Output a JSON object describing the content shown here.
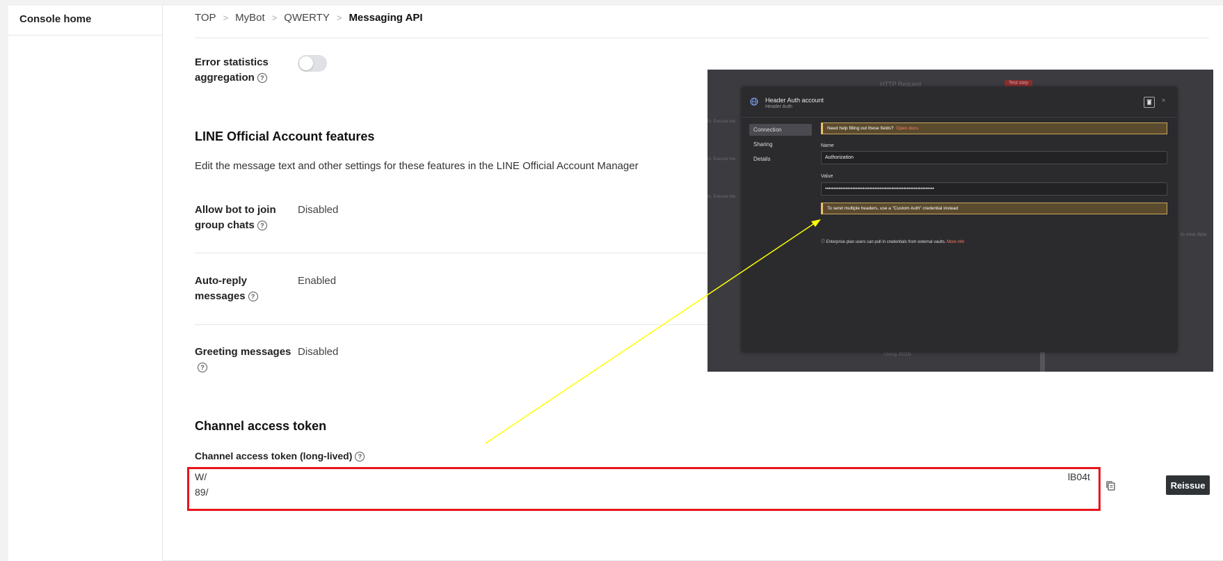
{
  "sidebar": {
    "home_label": "Console home"
  },
  "breadcrumb": [
    "TOP",
    "MyBot",
    "QWERTY",
    "Messaging API"
  ],
  "error_stats": {
    "label_line1": "Error statistics",
    "label_line2": "aggregation",
    "enabled": false
  },
  "features": {
    "heading": "LINE Official Account features",
    "description": "Edit the message text and other settings for these features in the LINE Official Account Manager",
    "rows": [
      {
        "label_line1": "Allow bot to join",
        "label_line2": "group chats",
        "value": "Disabled"
      },
      {
        "label_line1": "Auto-reply",
        "label_line2": "messages",
        "value": "Enabled"
      },
      {
        "label_line1": "Greeting messages",
        "label_line2": "",
        "value": "Disabled"
      }
    ]
  },
  "token": {
    "heading": "Channel access token",
    "field_label": "Channel access token (long-lived)",
    "line1_start": "W/",
    "line1_end": "lB04t",
    "line2_start": "89/",
    "reissue_label": "Reissue"
  },
  "overlay": {
    "annotation_color": "#ffff00",
    "highlight_color": "#e8141b",
    "bg_node_title": "HTTP Request",
    "bg_chip": "Test step",
    "bg_hint": "fo. Execute the",
    "bg_right_hint": "to view data",
    "bg_bottom": "Using JSON",
    "modal": {
      "title": "Header Auth account",
      "subtitle": "Header Auth",
      "close": "×",
      "nav": [
        "Connection",
        "Sharing",
        "Details"
      ],
      "help_banner": "Need help filling out these fields?",
      "help_link": "Open docs",
      "name_label": "Name",
      "name_value": "Authorization",
      "value_label": "Value",
      "value_masked": "••••••••••••••••••••••••••••••••••••••••••••••••••••••••••••••••",
      "warning_banner": "To send multiple headers, use a \"Custom Auth\" credential instead",
      "note_text": "Enterprise plan users can pull in credentials from external vaults.",
      "note_link": "More info"
    }
  }
}
